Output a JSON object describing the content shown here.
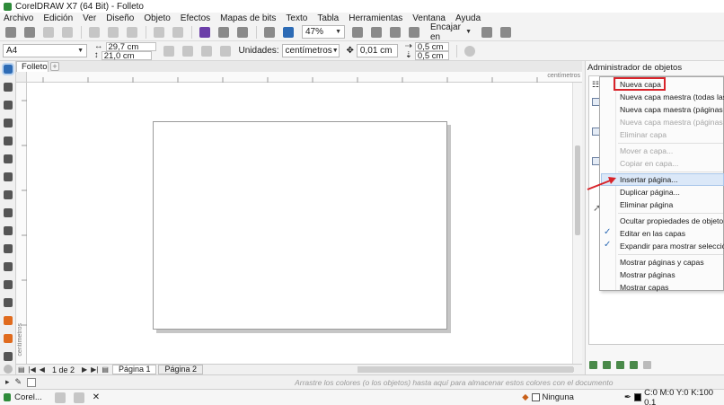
{
  "window": {
    "title": "CorelDRAW X7 (64 Bit) - Folleto"
  },
  "menu": [
    "Archivo",
    "Edición",
    "Ver",
    "Diseño",
    "Objeto",
    "Efectos",
    "Mapas de bits",
    "Texto",
    "Tabla",
    "Herramientas",
    "Ventana",
    "Ayuda"
  ],
  "toolbar": {
    "zoom": "47%",
    "snap_label": "Encajar en"
  },
  "properties": {
    "page_size": "A4",
    "width": "29,7 cm",
    "height": "21,0 cm",
    "units_label": "Unidades:",
    "units_value": "centímetros",
    "nudge": "0,01 cm",
    "dup_x": "0,5 cm",
    "dup_y": "0,5 cm"
  },
  "document": {
    "tab_name": "Folleto",
    "ruler_unit": "centímetros"
  },
  "page_nav": {
    "page_counter": "1 de 2",
    "pages": [
      "Página 1",
      "Página 2"
    ]
  },
  "panel": {
    "title": "Administrador de objetos"
  },
  "context_menu": {
    "items": [
      {
        "label": "Nueva capa",
        "disabled": false
      },
      {
        "label": "Nueva capa maestra (todas las pági",
        "disabled": false
      },
      {
        "label": "Nueva capa maestra (páginas impa",
        "disabled": false
      },
      {
        "label": "Nueva capa maestra (páginas pare",
        "disabled": true
      },
      {
        "label": "Eliminar capa",
        "disabled": true
      },
      {
        "label": "Mover a capa...",
        "disabled": true
      },
      {
        "label": "Copiar en capa...",
        "disabled": true
      },
      {
        "label": "Insertar página...",
        "disabled": false,
        "highlighted": true
      },
      {
        "label": "Duplicar página...",
        "disabled": false
      },
      {
        "label": "Eliminar página",
        "disabled": false
      },
      {
        "label": "Ocultar propiedades de objeto",
        "disabled": false
      },
      {
        "label": "Editar en las capas",
        "disabled": false,
        "checked": true
      },
      {
        "label": "Expandir para mostrar selección",
        "disabled": false,
        "checked": true
      },
      {
        "label": "Mostrar páginas y capas",
        "disabled": false
      },
      {
        "label": "Mostrar páginas",
        "disabled": false
      },
      {
        "label": "Mostrar capas",
        "disabled": false
      }
    ]
  },
  "color_bar": {
    "hint": "Arrastre los colores (o los objetos) hasta aquí para almacenar estos colores con el documento"
  },
  "status": {
    "taskbar_app": "Corel...",
    "fill": "Ninguna",
    "outline": "C:0 M:0 Y:0 K:100  0,1"
  },
  "colors": {
    "highlight_box": "#d8232a",
    "menu_highlight": "#dbe8f8",
    "check": "#2d6bb5"
  }
}
